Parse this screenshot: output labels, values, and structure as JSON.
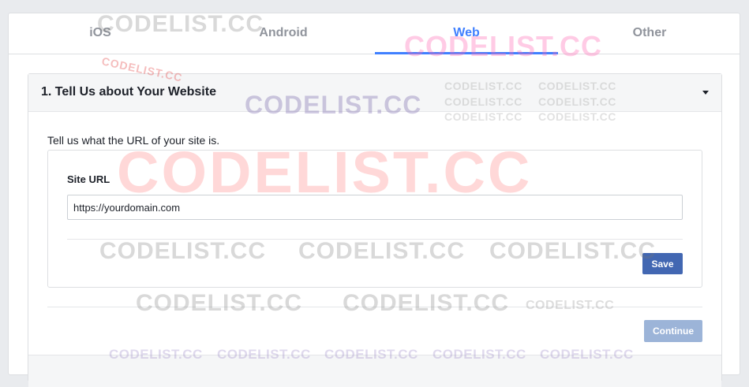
{
  "tabs": [
    {
      "label": "iOS",
      "active": false
    },
    {
      "label": "Android",
      "active": false
    },
    {
      "label": "Web",
      "active": true
    },
    {
      "label": "Other",
      "active": false
    }
  ],
  "section": {
    "title": "1. Tell Us about Your Website",
    "intro": "Tell us what the URL of your site is.",
    "field_label": "Site URL",
    "url_value": "https://yourdomain.com",
    "save_label": "Save",
    "continue_label": "Continue"
  },
  "watermark": {
    "text": "CODELIST.CC"
  },
  "colors": {
    "accent": "#4080ff",
    "primary_button": "#4267b2",
    "disabled_button": "#9cb4d8",
    "background": "#e9ebee"
  }
}
